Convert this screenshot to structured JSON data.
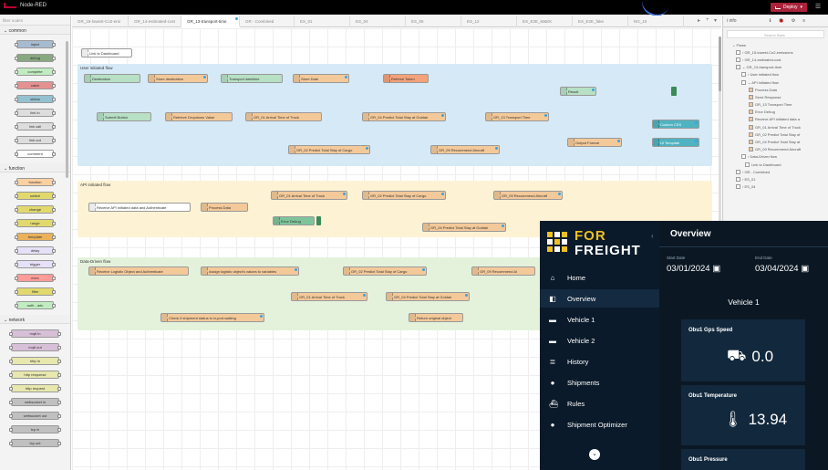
{
  "header": {
    "app_title": "Node-RED",
    "deploy_label": "Deploy",
    "deploy_caret": "▾",
    "menu_icon": "☰"
  },
  "palette": {
    "filter_placeholder": "filter nodes",
    "categories": {
      "common": "⌄ common",
      "function": "⌄ function",
      "network": "⌄ network"
    },
    "common_nodes": [
      "inject",
      "debug",
      "complete",
      "catch",
      "status",
      "link in",
      "link call",
      "link out",
      "comment"
    ],
    "function_nodes": [
      "function",
      "switch",
      "change",
      "range",
      "template",
      "delay",
      "trigger",
      "exec",
      "filter",
      "auth - adc"
    ],
    "network_nodes": [
      "mqtt in",
      "mqtt out",
      "http in",
      "http response",
      "http request",
      "websocket in",
      "websocket out",
      "tcp in",
      "tcp out"
    ]
  },
  "tabs": [
    {
      "label": "GR_15-lowest-Co2-emi",
      "active": false
    },
    {
      "label": "GR_14-estimated-cost",
      "active": false
    },
    {
      "label": "GR_13-transport-time",
      "active": true
    },
    {
      "label": "GR - Combined",
      "active": false
    },
    {
      "label": "ES_01",
      "active": false
    },
    {
      "label": "ES_04",
      "active": false
    },
    {
      "label": "ES_05",
      "active": false
    },
    {
      "label": "ES_12",
      "active": false
    },
    {
      "label": "ES_E2E_M&EK",
      "active": false
    },
    {
      "label": "ES_E2E_fake",
      "active": false
    },
    {
      "label": "NG_10",
      "active": false
    }
  ],
  "tab_controls": {
    "prev": "▸",
    "add": "+",
    "list": "▾"
  },
  "workspace": {
    "top_node": "Link to Dashboard",
    "groups": {
      "user": "User initiated flow",
      "api": "API initiated flow",
      "data": "Data-Driven flow"
    },
    "user_nodes": {
      "destination": "Destination",
      "store_destination": "Store destination",
      "transport_datetime": "Transport datetime",
      "store_date": "Store Date",
      "refresh_token": "Refresh Token",
      "submit_button": "Submit Button",
      "retrieve_dropdown": "Retrieve Dropdown Value",
      "arrival_truck": "GR_01 Arrival Time of Truck",
      "predict_golden": "GR_04 Predict Total Stay at Goldair",
      "transport_time": "GR_13 Transport Time",
      "result": "Result",
      "custom_css": "Custom CSS",
      "output_format": "Output Format",
      "ui_template": "UI Template",
      "predict_cargo": "GR_02 Predict Total Stay of Cargo",
      "recommend_aircraft": "GR_09 Recommend Aircraft"
    },
    "api_nodes": {
      "receive": "Receive API initiated data and Authenticate",
      "process": "Process Data",
      "arrival_truck": "GR_01 Arrival Time of Truck",
      "predict_cargo": "GR_02 Predict Total Stay of Cargo",
      "recommend_aircraft": "GR_09 Recommend Aircraft",
      "error_debug": "Error Debug",
      "predict_golden": "GR_04 Predict Total Stay at Goldair"
    },
    "data_nodes": {
      "receive": "Receive Logistic Object and Authenticate",
      "assign": "Assign logistic object's values to variables",
      "predict_cargo": "GR_02 Predict Total Stay of Cargo",
      "recommend": "GR_09 Recommend Ai",
      "arrival_truck": "GR_01 Arrival Time of Truck",
      "predict_golden": "GR_04 Predict Total Stay at Goldair",
      "check_shipment": "Check if shipment status is in-port-waiting",
      "return_object": "Return original object"
    }
  },
  "sidebar": {
    "tab_info": "i info",
    "icons": [
      "ℹ",
      "🐞",
      "⚙",
      "≡"
    ],
    "search_placeholder": "Search flows",
    "tree": [
      "⌄ Flows",
      "› GR_15-lowest-Co2-emissions",
      "› GR_14-estimated-cost",
      "⌄ GR_13-transport-time",
      "› User initiated flow",
      "⌄ API initiated flow",
      "Process Data",
      "Send Response",
      "GR_13 Transport Time",
      "Error Debug",
      "Receive API initiated data a",
      "GR_01 Arrival Time of Truck",
      "GR_02 Predict Total Stay of",
      "GR_04 Predict Total Stay at",
      "GR_09 Recommend Aircraft",
      "› Data-Driven flow",
      "Link to Dashboard",
      "› GR - Combined",
      "› ES_01",
      "› ES_04"
    ]
  },
  "dashboard": {
    "brand_line1": "FOR",
    "brand_line2": "FREIGHT",
    "collapse_icon": "‹",
    "nav": [
      {
        "label": "Home",
        "icon": "⌂",
        "icon_name": "home-icon",
        "active": false
      },
      {
        "label": "Overview",
        "icon": "◧",
        "icon_name": "overview-icon",
        "active": true
      },
      {
        "label": "Vehicle 1",
        "icon": "▬",
        "icon_name": "car-icon",
        "active": false
      },
      {
        "label": "Vehicle 2",
        "icon": "▬",
        "icon_name": "car-icon",
        "active": false
      },
      {
        "label": "History",
        "icon": "≣",
        "icon_name": "history-icon",
        "active": false
      },
      {
        "label": "Shipments",
        "icon": "●",
        "icon_name": "shipments-icon",
        "active": false
      },
      {
        "label": "Rules",
        "icon": "⛴",
        "icon_name": "rules-icon",
        "active": false
      },
      {
        "label": "Shipment Optimizer",
        "icon": "●",
        "icon_name": "optimizer-icon",
        "active": false
      }
    ],
    "chevron": "⌄",
    "overview_title": "Overview",
    "start_label": "Start Date",
    "start_value": "03/01/2024",
    "end_label": "End Date",
    "end_value": "03/04/2024",
    "calendar_icon": "▣",
    "vehicle_title": "Vehicle 1",
    "cards": [
      {
        "label": "Obu1 Gps Speed",
        "value": "0.0",
        "icon": "⛟",
        "icon_name": "car-icon"
      },
      {
        "label": "Obu1 Temperature",
        "value": "13.94",
        "icon": "🌡",
        "icon_name": "thermometer-icon"
      },
      {
        "label": "Obu1 Pressure",
        "value": "",
        "icon": "",
        "icon_name": ""
      }
    ]
  },
  "colors": {
    "header_bg": "#000000",
    "deploy_red": "#a8223a",
    "group_user": "#d6e9f7",
    "group_api": "#fdf3d4",
    "group_data": "#e4f2dc",
    "node_orange": "#f4c99a",
    "node_green": "#b7e0c4",
    "node_teal": "#4fb3c1",
    "dash_bg": "#0b1824",
    "brand_yellow": "#f0c020"
  }
}
